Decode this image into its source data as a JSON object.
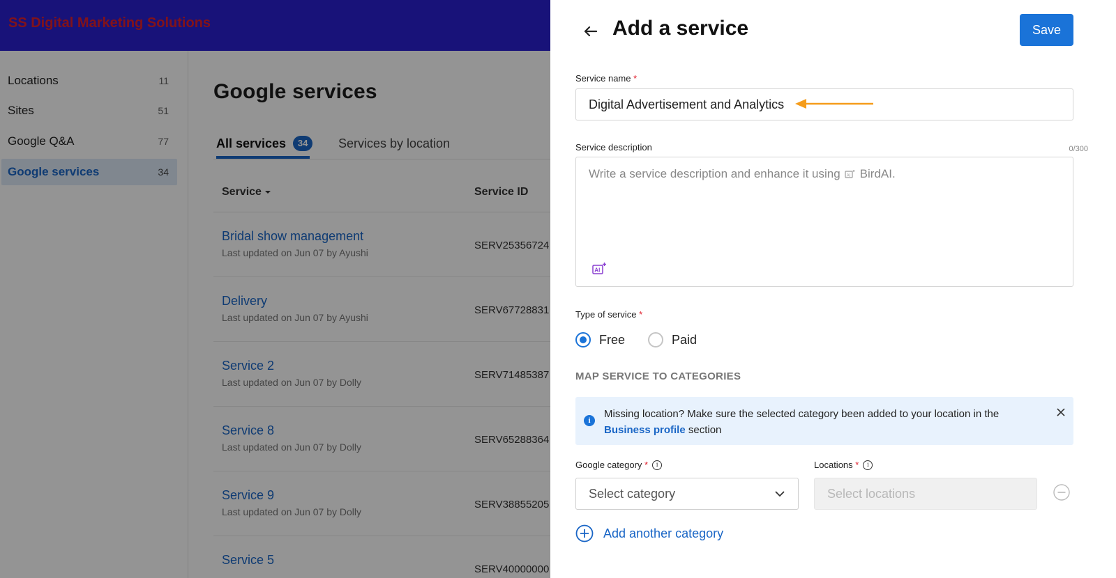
{
  "topbar": {
    "brand": "SS Digital Marketing Solutions"
  },
  "sidebar": {
    "items": [
      {
        "label": "Locations",
        "count": "11"
      },
      {
        "label": "Sites",
        "count": "51"
      },
      {
        "label": "Google Q&A",
        "count": "77"
      },
      {
        "label": "Google services",
        "count": "34",
        "active": true
      }
    ]
  },
  "main": {
    "title": "Google services",
    "tabs": [
      {
        "label": "All services",
        "badge": "34"
      },
      {
        "label": "Services by location"
      }
    ],
    "columns": {
      "service": "Service",
      "service_id": "Service ID"
    },
    "rows": [
      {
        "name": "Bridal show management",
        "meta": "Last updated on Jun 07 by Ayushi",
        "id": "SERV25356724"
      },
      {
        "name": "Delivery",
        "meta": "Last updated on Jun 07 by Ayushi",
        "id": "SERV67728831"
      },
      {
        "name": "Service 2",
        "meta": "Last updated on Jun 07 by Dolly",
        "id": "SERV71485387"
      },
      {
        "name": "Service 8",
        "meta": "Last updated on Jun 07 by Dolly",
        "id": "SERV65288364"
      },
      {
        "name": "Service 9",
        "meta": "Last updated on Jun 07 by Dolly",
        "id": "SERV38855205"
      },
      {
        "name": "Service 5",
        "meta": "",
        "id": "SERV40000000"
      }
    ]
  },
  "drawer": {
    "title": "Add a service",
    "save_label": "Save",
    "service_name_label": "Service name",
    "service_name_value": "Digital Advertisement and Analytics",
    "description_label": "Service description",
    "description_counter": "0/300",
    "description_placeholder_pre": "Write a service description and enhance it using",
    "description_placeholder_post": "BirdAI.",
    "type_label": "Type of service",
    "type_options": [
      {
        "label": "Free",
        "selected": true
      },
      {
        "label": "Paid",
        "selected": false
      }
    ],
    "section_heading": "MAP SERVICE TO CATEGORIES",
    "banner": {
      "text_pre": "Missing location? Make sure the selected category been added to your location in the",
      "link": "Business profile",
      "text_post": "section"
    },
    "google_category_label": "Google category",
    "google_category_placeholder": "Select category",
    "locations_label": "Locations",
    "locations_placeholder": "Select locations",
    "add_category_label": "Add another category",
    "required_mark": "*",
    "info_glyph": "i",
    "accent_color": "#1a73d8",
    "annotation_color": "#f59c1a"
  }
}
